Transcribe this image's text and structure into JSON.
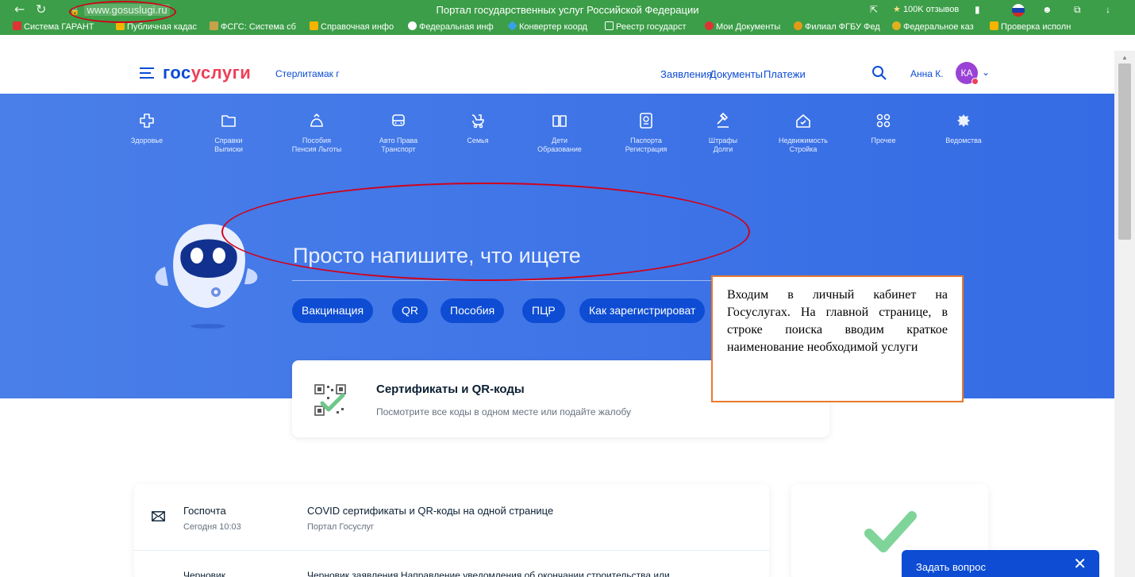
{
  "browser": {
    "url": "www.gosuslugi.ru",
    "page_title": "Портал государственных услуг Российской Федерации",
    "reviews": "100K отзывов",
    "bookmarks": [
      "Система ГАРАНТ",
      "Публичная кадас",
      "ФСГС: Система сб",
      "Справочная инфо",
      "Федеральная инф",
      "Конвертер коорд",
      "Реестр государст",
      "Мои Документы",
      "Филиал ФГБУ Фед",
      "Федеральное каз",
      "Проверка исполн"
    ]
  },
  "header": {
    "logo_a": "гос",
    "logo_b": "услуги",
    "city": "Стерлитамак г",
    "nav": [
      "Заявления",
      "Документы",
      "Платежи"
    ],
    "user": "Анна К.",
    "avatar": "КА"
  },
  "categories": [
    {
      "l1": "Здоровье",
      "l2": "",
      "icon": "health-icon"
    },
    {
      "l1": "Справки",
      "l2": "Выписки",
      "icon": "folder-icon"
    },
    {
      "l1": "Пособия",
      "l2": "Пенсия Льготы",
      "icon": "bag-icon"
    },
    {
      "l1": "Авто Права",
      "l2": "Транспорт",
      "icon": "car-icon"
    },
    {
      "l1": "Семья",
      "l2": "",
      "icon": "stroller-icon"
    },
    {
      "l1": "Дети",
      "l2": "Образование",
      "icon": "book-icon"
    },
    {
      "l1": "Паспорта",
      "l2": "Регистрация",
      "icon": "passport-icon"
    },
    {
      "l1": "Штрафы",
      "l2": "Долги",
      "icon": "gavel-icon"
    },
    {
      "l1": "Недвижимость",
      "l2": "Стройка",
      "icon": "house-icon"
    },
    {
      "l1": "Прочее",
      "l2": "",
      "icon": "grid-icon"
    },
    {
      "l1": "Ведомства",
      "l2": "",
      "icon": "emblem-icon"
    }
  ],
  "search": {
    "placeholder": "Просто напишите, что ищете",
    "chips": [
      "Вакцинация",
      "QR",
      "Пособия",
      "ПЦР",
      "Как зарегистрироват"
    ]
  },
  "cert": {
    "title": "Сертификаты и QR-коды",
    "subtitle": "Посмотрите все коды в одном месте или подайте жалобу"
  },
  "annotation": "Входим в личный кабинет на Госуслугах. На главной странице, в строке поиска вводим краткое наименование необходимой услуги",
  "feed": [
    {
      "from": "Госпочта",
      "time": "Сегодня 10:03",
      "message": "COVID сертификаты и QR-коды на одной странице",
      "source": "Портал Госуслуг"
    },
    {
      "from": "Черновик",
      "message": "Черновик заявления Направление уведомления об окончании строительства или"
    }
  ],
  "ask": {
    "label": "Задать вопрос",
    "close": "✕"
  },
  "colors": {
    "brand_blue": "#0d4cd3",
    "brand_red": "#ee3f58",
    "hero": "#3d73e6",
    "browser_green": "#3c9e48"
  }
}
